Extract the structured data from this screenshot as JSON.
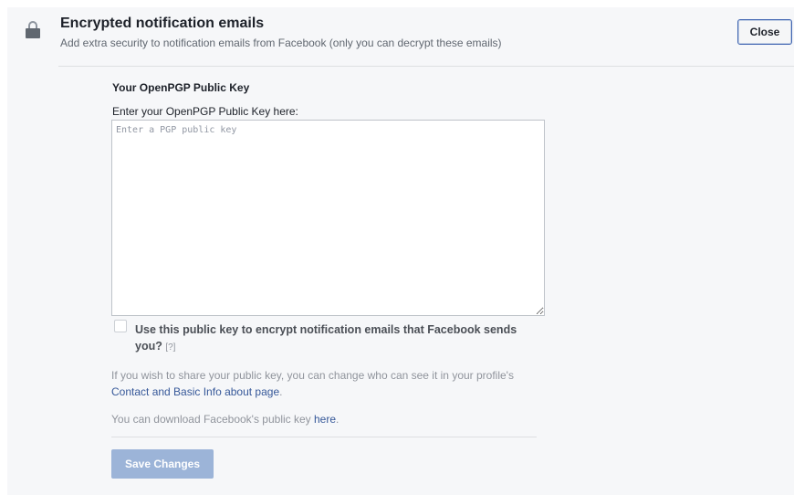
{
  "header": {
    "title": "Encrypted notification emails",
    "subtitle": "Add extra security to notification emails from Facebook (only you can decrypt these emails)",
    "close_label": "Close",
    "icon": "lock-icon"
  },
  "form": {
    "section_title": "Your OpenPGP Public Key",
    "key_label": "Enter your OpenPGP Public Key here:",
    "key_placeholder": "Enter a PGP public key",
    "key_value": "",
    "encrypt_checkbox_checked": false,
    "encrypt_label": "Use this public key to encrypt notification emails that Facebook sends you?",
    "help_link": "[?]",
    "share_text_before": "If you wish to share your public key, you can change who can see it in your profile's ",
    "share_link": "Contact and Basic Info about page",
    "share_text_after": ".",
    "download_text_before": "You can download Facebook's public key ",
    "download_link": "here",
    "download_text_after": ".",
    "save_label": "Save Changes"
  },
  "colors": {
    "link": "#365899",
    "save_button_disabled": "#9cb4d8",
    "close_border": "#4267b2",
    "panel_background": "#f6f7f9"
  }
}
